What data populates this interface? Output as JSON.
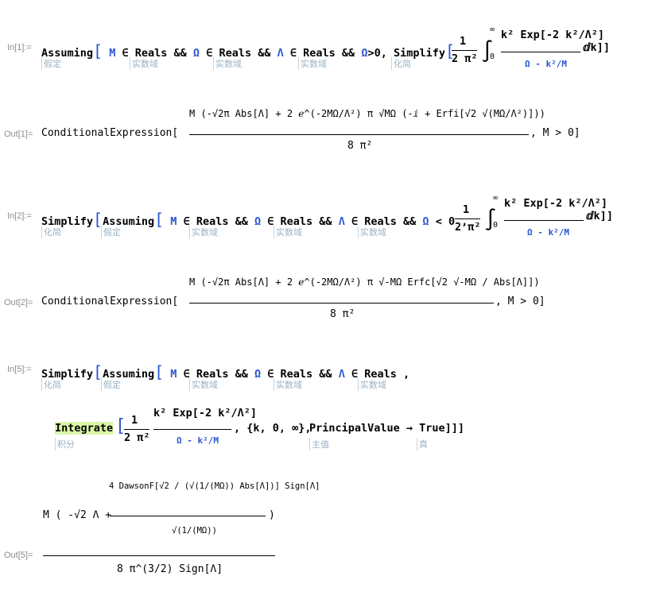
{
  "cells": [
    {
      "in_label": "In[1]:=",
      "in_text": "Assuming",
      "in_parts": [
        "M",
        "∈ Reals &&",
        "Ω",
        "∈ Reals &&",
        "Λ",
        "∈ Reals &&",
        "Ω",
        ">0, Simplify"
      ],
      "hints": [
        "假定",
        "实数域",
        "实数域",
        "实数域",
        "化简"
      ],
      "integrand_num": "k² Exp[-2 k²/Λ²]",
      "integrand_den": "Ω - k²/M",
      "prefactor_num": "1",
      "prefactor_den": "2 π²",
      "int_lims": [
        "0",
        "∞"
      ],
      "dk": "ⅆk]]",
      "out_label": "Out[1]=",
      "out_head": "ConditionalExpression[",
      "out_num": "M (-√2π Abs[Λ] + 2 ℯ^(-2MΩ/Λ²) π √MΩ (-ⅈ + Erfi[√2 √(MΩ/Λ²)]))",
      "out_den": "8 π²",
      "out_cond": ", M > 0]"
    },
    {
      "in_label": "In[2]:=",
      "in_text": "Simplify",
      "in_parts": [
        "Assuming",
        "M",
        "∈ Reals &&",
        "Ω",
        "∈ Reals &&",
        "Λ",
        "∈ Reals &&",
        "Ω",
        "< 0 ,"
      ],
      "hints": [
        "化简",
        "假定",
        "实数域",
        "实数域",
        "实数域"
      ],
      "integrand_num": "k² Exp[-2 k²/Λ²]",
      "integrand_den": "Ω - k²/M",
      "prefactor_num": "1",
      "prefactor_den": "2 π²",
      "int_lims": [
        "0",
        "∞"
      ],
      "dk": "ⅆk]]",
      "out_label": "Out[2]=",
      "out_head": "ConditionalExpression[",
      "out_num": "M (-√2π Abs[Λ] + 2 ℯ^(-2MΩ/Λ²) π √-MΩ Erfc[√2 √-MΩ / Abs[Λ]])",
      "out_den": "8 π²",
      "out_cond": ", M > 0]"
    },
    {
      "in_label": "In[5]:=",
      "in_text": "Simplify",
      "in_parts": [
        "Assuming",
        "M",
        "∈ Reals &&",
        "Ω",
        "∈ Reals &&",
        "Λ",
        "∈ Reals ,"
      ],
      "hints": [
        "化简",
        "假定",
        "实数域",
        "实数域",
        "实数域"
      ],
      "line2": {
        "integrate": "Integrate",
        "prefactor_num": "1",
        "prefactor_den": "2 π²",
        "integrand_num": "k² Exp[-2 k²/Λ²]",
        "integrand_den": "Ω - k²/M",
        "range": ", {k, 0, ∞},",
        "option": "PrincipalValue → True]]]",
        "hints": [
          "积分",
          "主值",
          "真"
        ]
      },
      "out_label": "Out[5]=",
      "out_num_top": "4 DawsonF[√2 / (√(1/(MΩ)) Abs[Λ])] Sign[Λ]",
      "out_num_left": "M ( -√2 Λ +",
      "out_num_bottom": "√(1/(MΩ))",
      "out_den": "8 π^(3/2) Sign[Λ]"
    }
  ]
}
